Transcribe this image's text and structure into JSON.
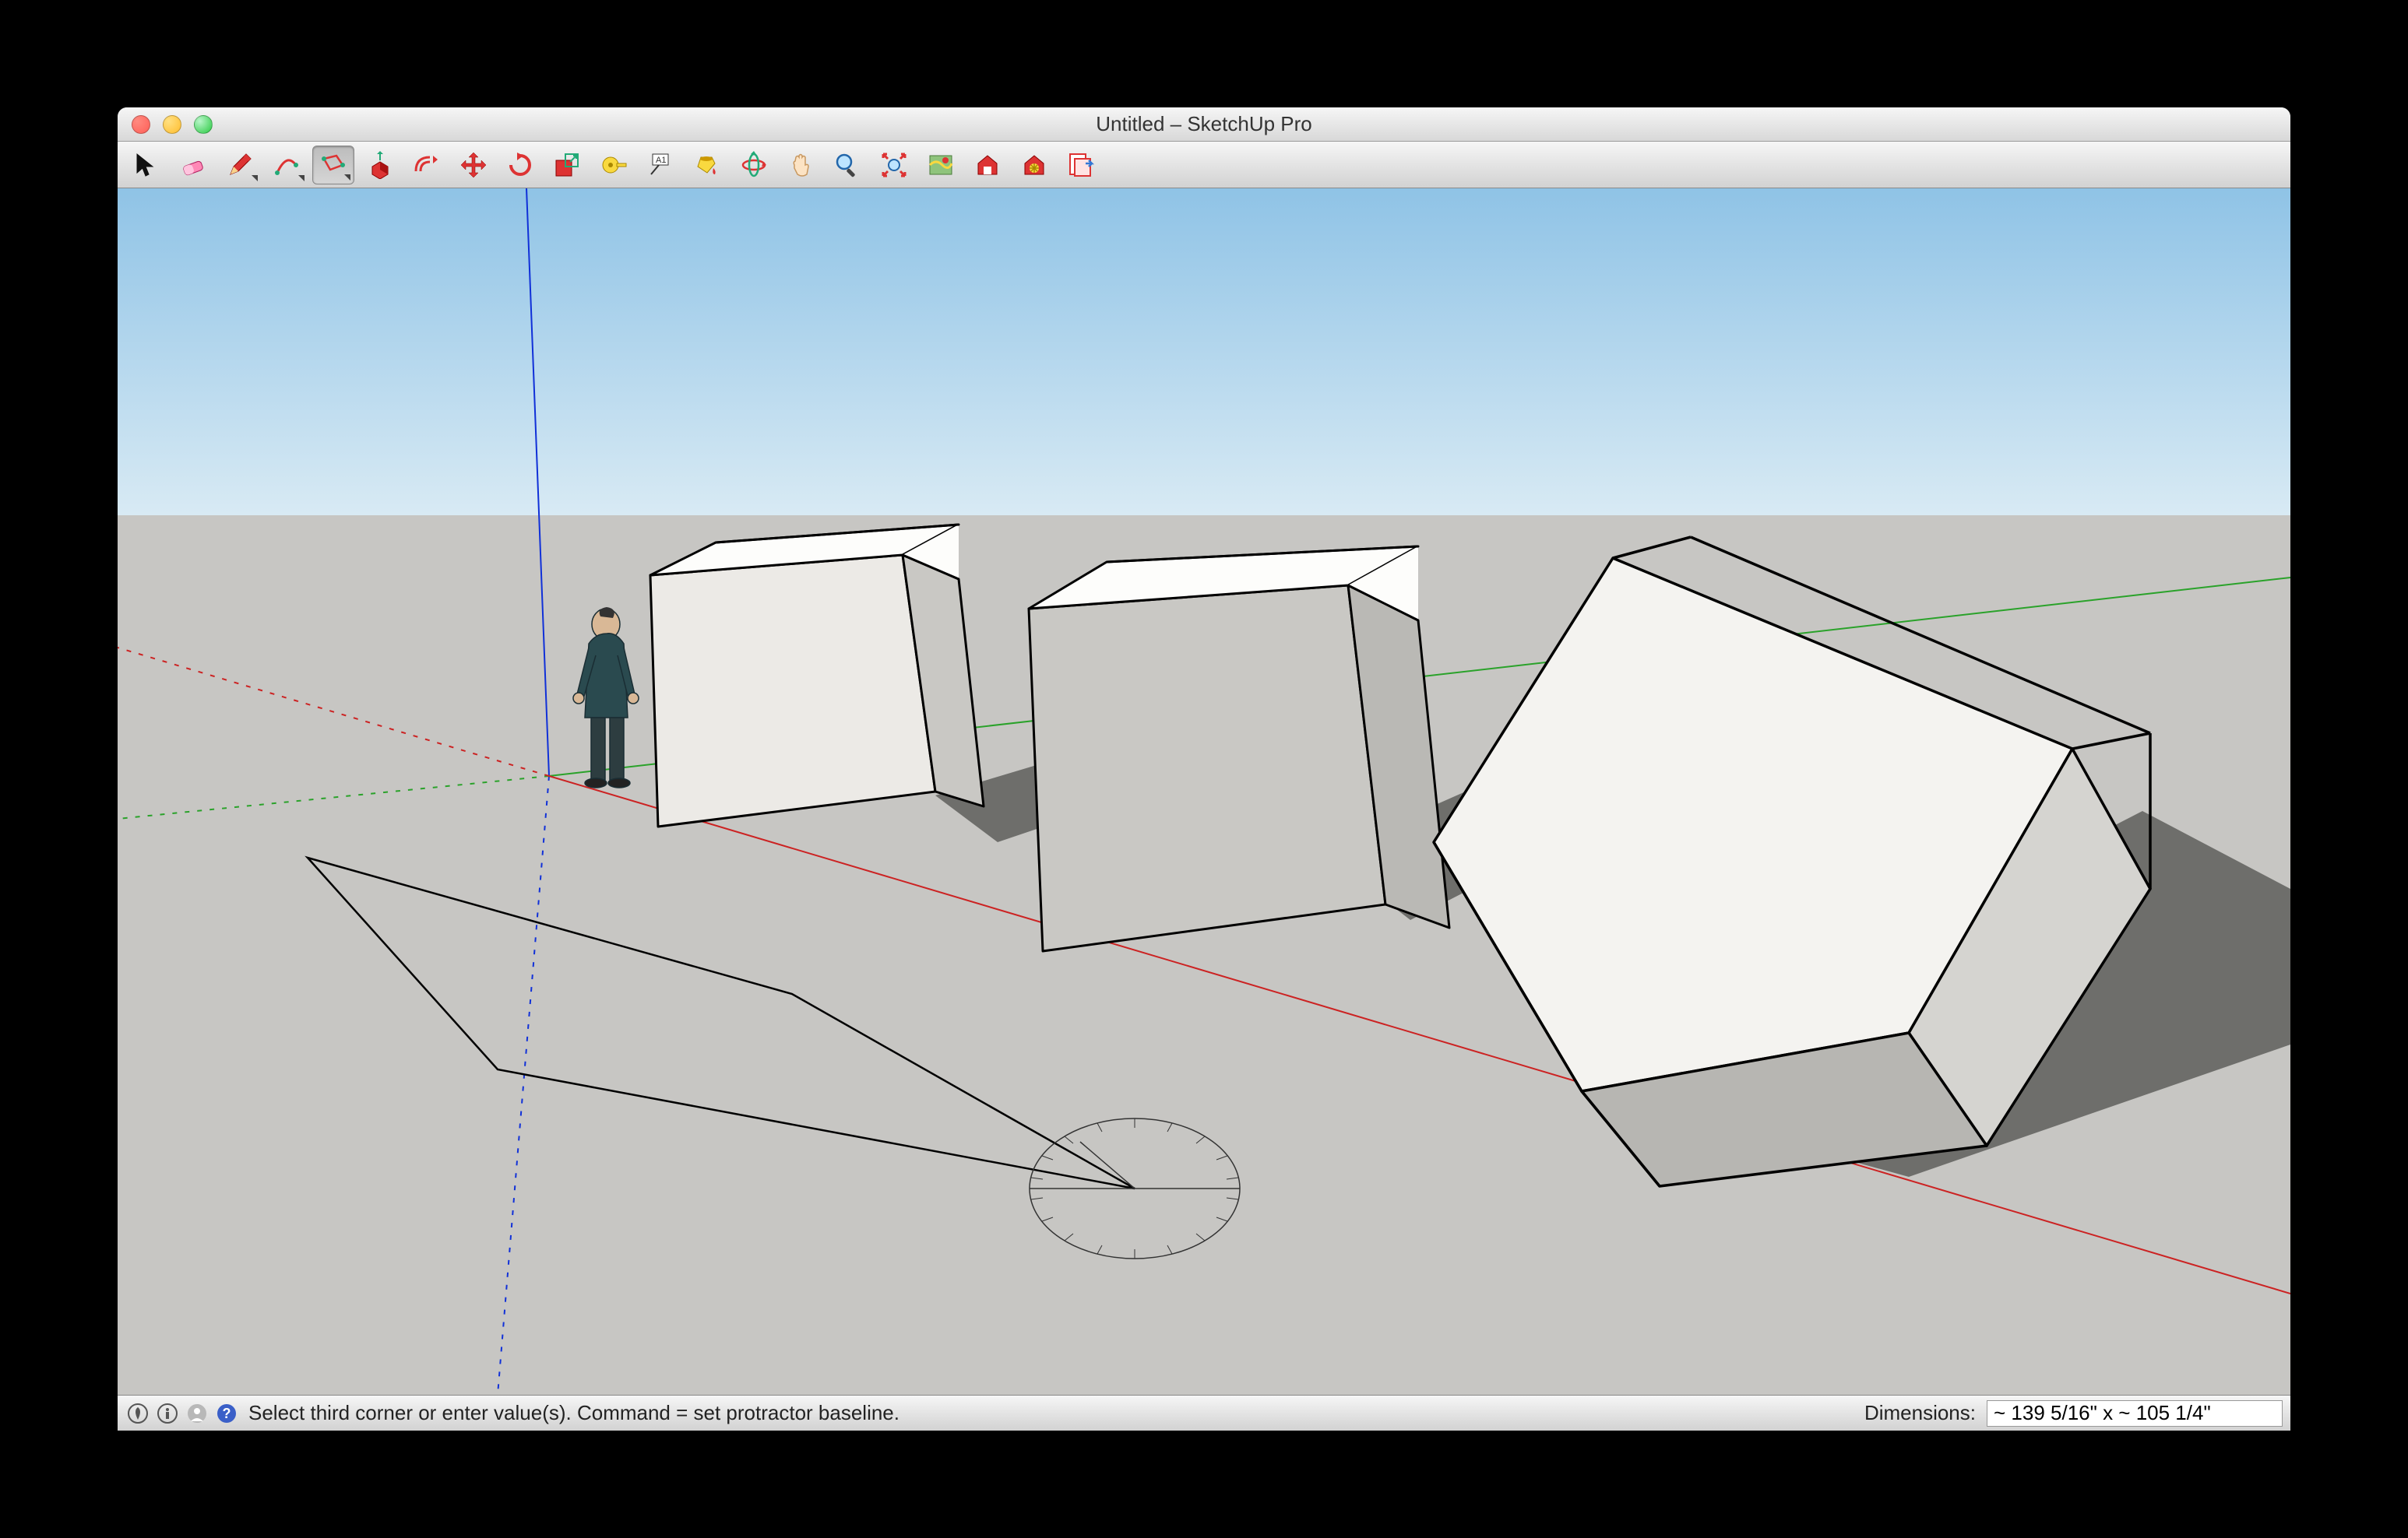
{
  "window": {
    "title": "Untitled – SketchUp Pro"
  },
  "toolbar": {
    "tools": [
      {
        "name": "select",
        "label": "Select"
      },
      {
        "name": "eraser",
        "label": "Eraser"
      },
      {
        "name": "line",
        "label": "Line"
      },
      {
        "name": "arc",
        "label": "Arc"
      },
      {
        "name": "shape",
        "label": "Shape"
      },
      {
        "name": "pushpull",
        "label": "Push/Pull"
      },
      {
        "name": "offset",
        "label": "Offset"
      },
      {
        "name": "move",
        "label": "Move"
      },
      {
        "name": "rotate",
        "label": "Rotate"
      },
      {
        "name": "scale",
        "label": "Scale"
      },
      {
        "name": "tape",
        "label": "Tape Measure"
      },
      {
        "name": "text",
        "label": "Text"
      },
      {
        "name": "paint",
        "label": "Paint Bucket"
      },
      {
        "name": "orbit",
        "label": "Orbit"
      },
      {
        "name": "pan",
        "label": "Pan"
      },
      {
        "name": "zoom",
        "label": "Zoom"
      },
      {
        "name": "zoom-extents",
        "label": "Zoom Extents"
      },
      {
        "name": "geo",
        "label": "Add Location"
      },
      {
        "name": "warehouse",
        "label": "3D Warehouse"
      },
      {
        "name": "extensions",
        "label": "Extension Warehouse"
      },
      {
        "name": "layout",
        "label": "Send to LayOut"
      }
    ],
    "selected_index": 4
  },
  "status": {
    "icons": [
      "geo-info",
      "info",
      "user",
      "help"
    ],
    "message": "Select third corner or enter value(s). Command = set protractor baseline.",
    "dimensions_label": "Dimensions:",
    "dimensions_value": "~ 139 5/16\" x ~ 105 1/4\""
  },
  "scene": {
    "axes": {
      "x": "red",
      "y": "green",
      "z": "blue"
    },
    "objects": [
      "figure-person",
      "cube-1",
      "cube-2",
      "cube-3-rotated",
      "rectangle-in-progress",
      "protractor"
    ],
    "horizon_sky": "#9ecbe7",
    "ground": "#c7c6c3"
  }
}
